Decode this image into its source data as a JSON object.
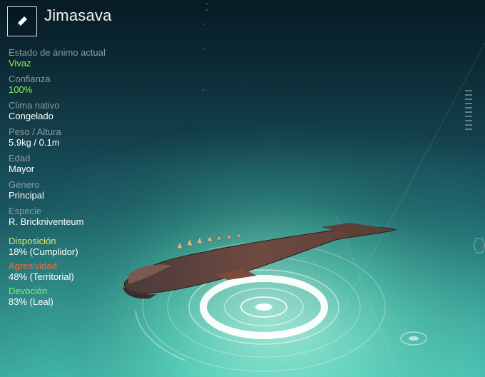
{
  "creature": {
    "name": "Jimasava",
    "edit_icon": "pencil-icon"
  },
  "stats": [
    {
      "label": "Estado de ánimo actual",
      "value": "Vivaz",
      "highlight": true
    },
    {
      "label": "Confianza",
      "value": "100%",
      "highlight": true
    },
    {
      "label": "Clima nativo",
      "value": "Congelado",
      "highlight": false
    },
    {
      "label": "Peso / Altura",
      "value": "5.9kg / 0.1m",
      "highlight": false
    },
    {
      "label": "Edad",
      "value": "Mayor",
      "highlight": false
    },
    {
      "label": "Género",
      "value": "Principal",
      "highlight": false
    },
    {
      "label": "Especie",
      "value": "R. Brickniventeum",
      "highlight": false
    }
  ],
  "traits": [
    {
      "label": "Disposición",
      "value": "18% (Cumplidor)",
      "color": "#d8e87a"
    },
    {
      "label": "Agresividad",
      "value": "48% (Territorial)",
      "color": "#e8704a"
    },
    {
      "label": "Devoción",
      "value": "83% (Leal)",
      "color": "#8cf25a"
    }
  ],
  "colors": {
    "highlight_green": "#8cf25a",
    "label_gray": "#8a9aa0",
    "background_teal": "#1c5e5a"
  }
}
